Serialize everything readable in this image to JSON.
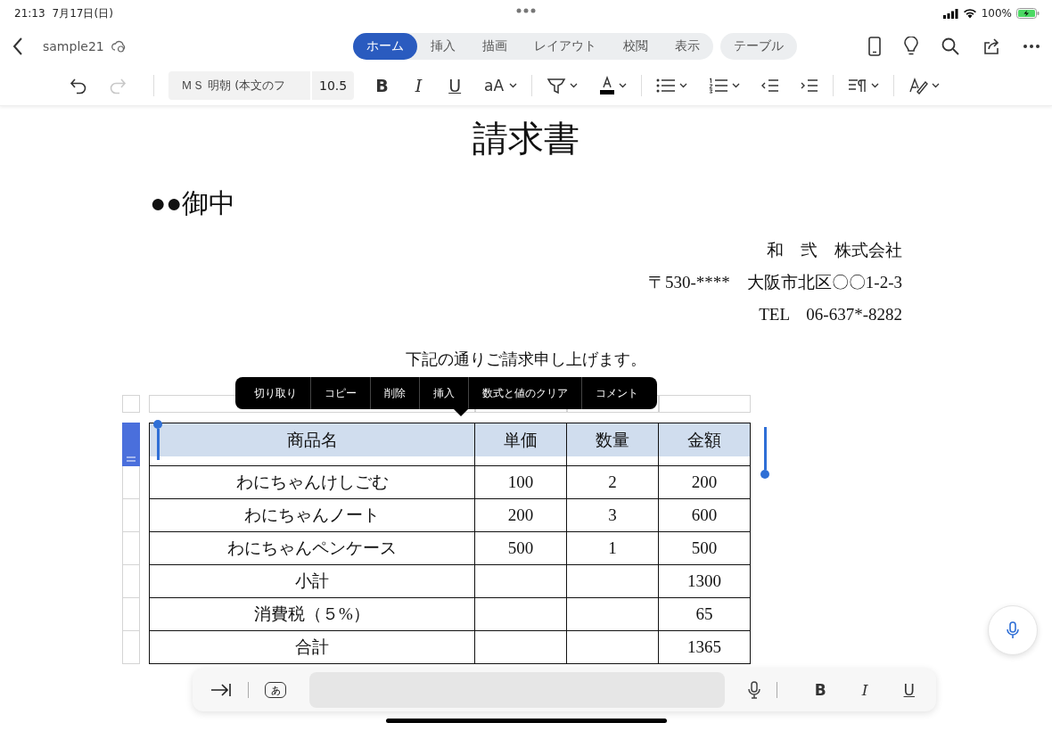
{
  "status_bar": {
    "time": "21:13",
    "date": "7月17日(日)",
    "battery": "100%"
  },
  "document_name": "sample21",
  "tabs": [
    {
      "label": "ホーム",
      "selected": true
    },
    {
      "label": "挿入",
      "selected": false
    },
    {
      "label": "描画",
      "selected": false
    },
    {
      "label": "レイアウト",
      "selected": false
    },
    {
      "label": "校閲",
      "selected": false
    },
    {
      "label": "表示",
      "selected": false
    }
  ],
  "context_tab": {
    "label": "テーブル"
  },
  "toolbar": {
    "history": [
      {
        "kind": "undo",
        "disabled": false
      },
      {
        "kind": "redo",
        "disabled": true
      }
    ],
    "font": "ＭＳ 明朝 (本文のフ",
    "size": "10.5",
    "bold": "B",
    "italic": "I",
    "underline": "U",
    "case": "aA"
  },
  "document": {
    "title": "請求書",
    "addressee": "●●御中",
    "sender_lines": [
      "和　弐　株式会社",
      "〒530-****　大阪市北区〇〇1-2-3",
      "TEL　06-637*-8282"
    ],
    "note": "下記の通りご請求申し上げます。",
    "table": {
      "columns": [
        "商品名",
        "単価",
        "数量",
        "金額"
      ],
      "header_selected": true,
      "rows": [
        {
          "cells": [
            "わにちゃんけしごむ",
            "100",
            "2",
            "200"
          ],
          "selected": false
        },
        {
          "cells": [
            "わにちゃんノート",
            "200",
            "3",
            "600"
          ],
          "selected": false
        },
        {
          "cells": [
            "わにちゃんペンケース",
            "500",
            "1",
            "500"
          ],
          "selected": false
        },
        {
          "cells": [
            "小計",
            "",
            "",
            "1300"
          ],
          "selected": false
        },
        {
          "cells": [
            "消費税（５%）",
            "",
            "",
            "65"
          ],
          "selected": false
        },
        {
          "cells": [
            "合計",
            "",
            "",
            "1365"
          ],
          "selected": false
        }
      ]
    }
  },
  "context_menu": [
    "切り取り",
    "コピー",
    "削除",
    "挿入",
    "数式と値のクリア",
    "コメント"
  ],
  "keyboard_bar": {
    "ime_key": "あ",
    "bold": "B",
    "italic": "I",
    "underline": "U"
  }
}
